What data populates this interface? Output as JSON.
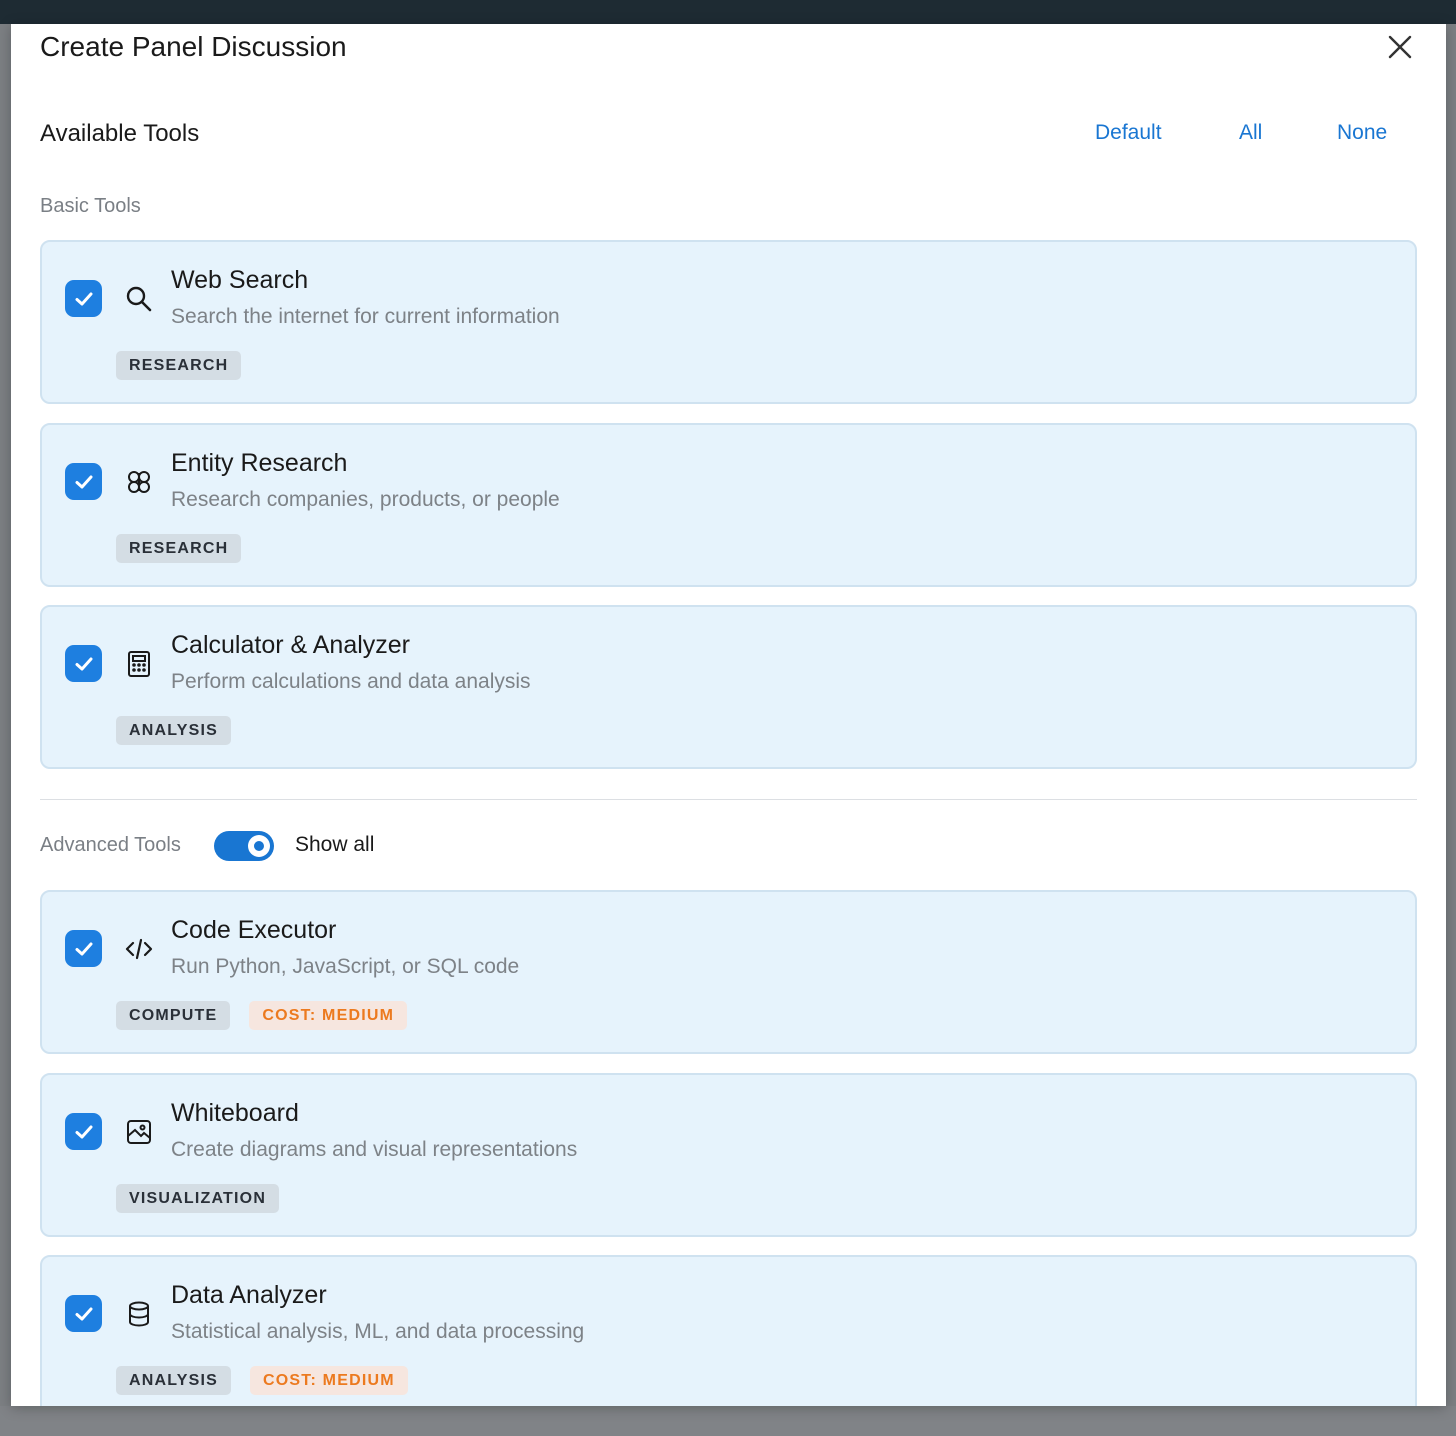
{
  "modal": {
    "title": "Create Panel Discussion"
  },
  "tools_section": {
    "title": "Available Tools",
    "links": {
      "default": "Default",
      "all": "All",
      "none": "None"
    },
    "basic_label": "Basic Tools",
    "advanced_label": "Advanced Tools",
    "show_all_label": "Show all",
    "show_all_enabled": true
  },
  "basic_tools": [
    {
      "name": "Web Search",
      "description": "Search the internet for current information",
      "icon": "search-icon",
      "checked": true,
      "tags": [
        "RESEARCH"
      ]
    },
    {
      "name": "Entity Research",
      "description": "Research companies, products, or people",
      "icon": "brain-icon",
      "checked": true,
      "tags": [
        "RESEARCH"
      ]
    },
    {
      "name": "Calculator & Analyzer",
      "description": "Perform calculations and data analysis",
      "icon": "calculator-icon",
      "checked": true,
      "tags": [
        "ANALYSIS"
      ]
    }
  ],
  "advanced_tools": [
    {
      "name": "Code Executor",
      "description": "Run Python, JavaScript, or SQL code",
      "icon": "code-icon",
      "checked": true,
      "tags": [
        "COMPUTE"
      ],
      "cost": "COST: MEDIUM"
    },
    {
      "name": "Whiteboard",
      "description": "Create diagrams and visual representations",
      "icon": "image-icon",
      "checked": true,
      "tags": [
        "VISUALIZATION"
      ]
    },
    {
      "name": "Data Analyzer",
      "description": "Statistical analysis, ML, and data processing",
      "icon": "database-icon",
      "checked": true,
      "tags": [
        "ANALYSIS"
      ],
      "cost": "COST: MEDIUM"
    }
  ],
  "colors": {
    "accent": "#1976d2",
    "card_bg": "#e6f3fc",
    "cost_text": "#ec7a1f"
  }
}
